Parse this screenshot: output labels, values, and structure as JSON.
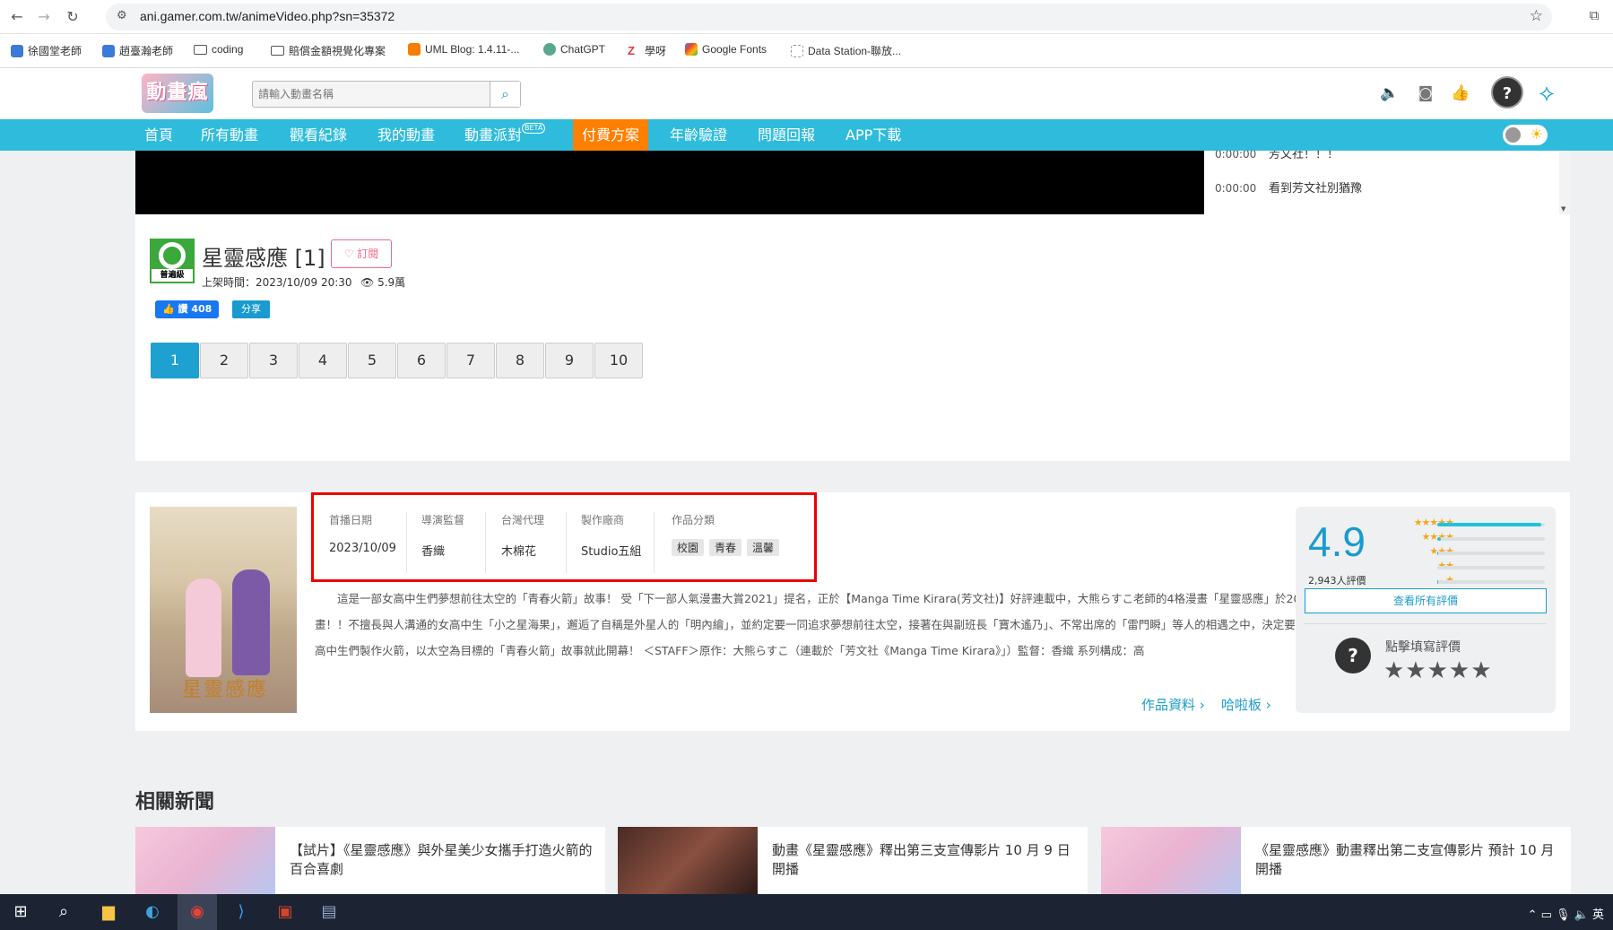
{
  "browser": {
    "url": "ani.gamer.com.tw/animeVideo.php?sn=35372",
    "bookmarks": [
      "徐國堂老師",
      "趙臺瀚老師",
      "coding",
      "賠償金額視覺化專案",
      "UML Blog: 1.4.11-...",
      "ChatGPT",
      "學呀",
      "Google Fonts",
      "Data Station-聯放..."
    ]
  },
  "site": {
    "logo": "動畫瘋",
    "search_placeholder": "請輸入動畫名稱",
    "nav": [
      "首頁",
      "所有動畫",
      "觀看紀錄",
      "我的動畫",
      "動畫派對",
      "付費方案",
      "年齡驗證",
      "問題回報",
      "APP下載"
    ],
    "beta": "BETA"
  },
  "player": {
    "danmu": [
      {
        "time": "0:00:00",
        "text": "芳文社！！！"
      },
      {
        "time": "0:00:00",
        "text": "看到芳文社別猶豫"
      }
    ]
  },
  "anime": {
    "rating_label": "普遍級",
    "title": "星靈感應 [1]",
    "subscribe": "訂閱",
    "release": "上架時間：2023/10/09 20:30",
    "views": "5.9萬",
    "like": "讚 408",
    "share": "分享",
    "episodes": [
      "1",
      "2",
      "3",
      "4",
      "5",
      "6",
      "7",
      "8",
      "9",
      "10"
    ]
  },
  "info": {
    "poster_title": "星靈感應",
    "meta": [
      {
        "label": "首播日期",
        "value": "2023/10/09"
      },
      {
        "label": "導演監督",
        "value": "香織"
      },
      {
        "label": "台灣代理",
        "value": "木棉花"
      },
      {
        "label": "製作廠商",
        "value": "Studio五組"
      }
    ],
    "genre_label": "作品分類",
    "genres": [
      "校園",
      "青春",
      "溫馨"
    ],
    "description": "　　這是一部女高中生們夢想前往太空的「青春火箭」故事！ 受「下一部人氣漫畫大賞2021」提名，正於【Manga Time Kirara(芳文社)】好評連載中，大熊らすこ老師的4格漫畫「星靈感應」於2023年秋季播出電視動畫！！不擅長與人溝通的女高中生「小之星海果」，邂逅了自稱是外星人的「明內繪」，並約定要一同追求夢想前往太空，接著在與副班長「寶木遙乃」、不常出席的「雷門瞬」等人的相遇之中，決定要一起造出火箭……，女高中生們製作火箭，以太空為目標的「青春火箭」故事就此開幕！ ＜STAFF＞原作：大熊らすこ（連載於「芳文社《Manga Time Kirara》」）監督：香織 系列構成：高",
    "link_info": "作品資料",
    "link_board": "哈啦板"
  },
  "score": {
    "value": "4.9",
    "count": "2,943人評價",
    "distribution": [
      0.97,
      0.03,
      0.01,
      0.0,
      0.01
    ],
    "all_reviews": "查看所有評價",
    "rate_prompt": "點擊填寫評價"
  },
  "news": {
    "title": "相關新聞",
    "items": [
      "【試片】《星靈感應》與外星美少女攜手打造火箭的百合喜劇",
      "動畫《星靈感應》釋出第三支宣傳影片 10 月 9 日開播",
      "《星靈感應》動畫釋出第二支宣傳影片 預計 10 月開播"
    ]
  },
  "taskbar": {
    "ime": "英"
  }
}
